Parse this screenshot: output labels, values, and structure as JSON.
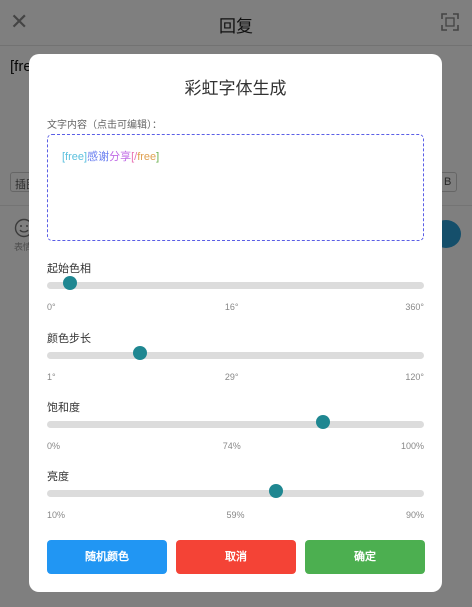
{
  "background": {
    "title": "回复",
    "text": "[fre",
    "attach_label": "插图",
    "right_label": "B",
    "emoji_label": "表情"
  },
  "modal": {
    "title": "彩虹字体生成",
    "content_label": "文字内容（点击可编辑）：",
    "editor_segments": [
      {
        "text": "[free]",
        "color": "#5bc0de"
      },
      {
        "text": "感谢",
        "color": "#6a7ff0"
      },
      {
        "text": "分享",
        "color": "#c06be6"
      },
      {
        "text": "[/",
        "color": "#e86fb2"
      },
      {
        "text": "free",
        "color": "#e0a050"
      },
      {
        "text": "]",
        "color": "#6ab04c"
      }
    ],
    "sliders": [
      {
        "label": "起始色相",
        "value_fraction": 0.06,
        "min": "0°",
        "mid": "16°",
        "max": "360°",
        "mid_pos": 0.49
      },
      {
        "label": "颜色步长",
        "value_fraction": 0.246,
        "min": "1°",
        "mid": "29°",
        "max": "120°",
        "mid_pos": 0.49
      },
      {
        "label": "饱和度",
        "value_fraction": 0.731,
        "min": "0%",
        "mid": "74%",
        "max": "100%",
        "mid_pos": 0.49
      },
      {
        "label": "亮度",
        "value_fraction": 0.607,
        "min": "10%",
        "mid": "59%",
        "max": "90%",
        "mid_pos": 0.5
      }
    ],
    "buttons": {
      "random": "随机颜色",
      "cancel": "取消",
      "confirm": "确定"
    }
  },
  "colors": {
    "random_button": "#2196f3",
    "cancel_button": "#f44336",
    "confirm_button": "#4caf50",
    "slider_thumb": "#1f8791",
    "editor_border": "#5a5ee6"
  }
}
